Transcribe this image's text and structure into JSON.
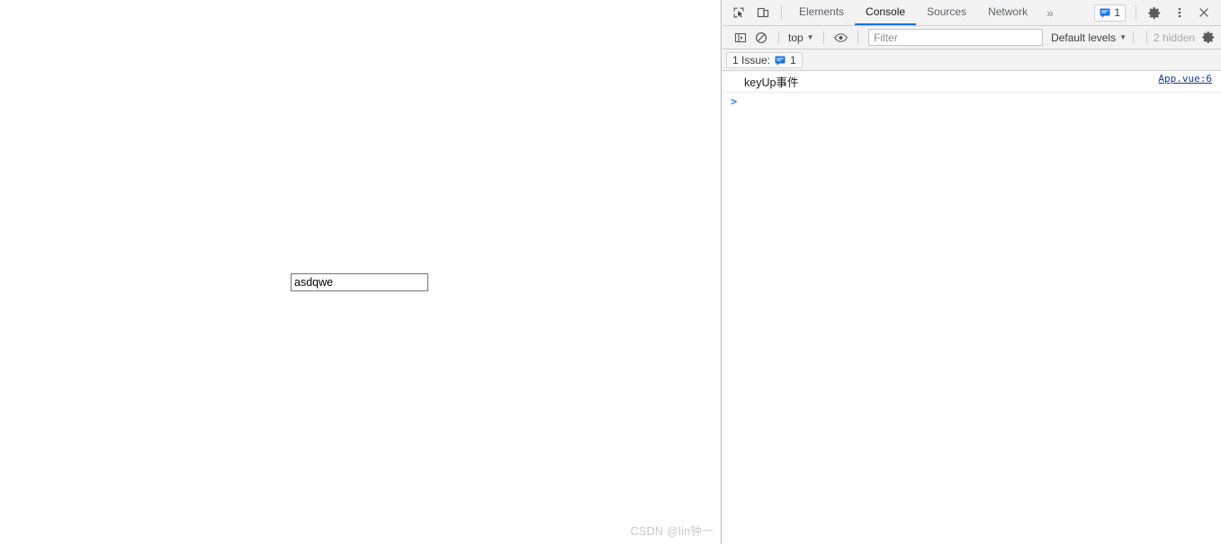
{
  "page": {
    "input": {
      "value": "asdqwe",
      "placeholder": ""
    },
    "watermark": "CSDN @lin钟一"
  },
  "devtools": {
    "toolbar_icons": {
      "inspect": "inspect-element-icon",
      "device": "device-toolbar-icon"
    },
    "tabs": [
      {
        "label": "Elements",
        "active": false
      },
      {
        "label": "Console",
        "active": true
      },
      {
        "label": "Sources",
        "active": false
      },
      {
        "label": "Network",
        "active": false
      }
    ],
    "more_tabs_label": "»",
    "issue_badge_count": "1",
    "right_icons": {
      "settings": "gear-icon",
      "more": "kebab-menu-icon",
      "close": "close-icon"
    },
    "console_toolbar": {
      "sidebar_toggle": "console-sidebar-icon",
      "clear": "clear-console-icon",
      "context": "top",
      "eye": "live-expression-eye-icon",
      "filter_placeholder": "Filter",
      "filter_value": "",
      "levels": "Default levels",
      "hidden_count": "2 hidden",
      "settings": "gear-icon"
    },
    "issue_bar": {
      "label": "1 Issue:",
      "count": "1"
    },
    "console": {
      "messages": [
        {
          "text": "keyUp事件",
          "source": "App.vue:6"
        }
      ],
      "prompt_caret": ">"
    }
  },
  "colors": {
    "accent_blue": "#1a73e8",
    "link_navy": "#1d3a8a",
    "toolbar_bg": "#f3f3f3",
    "border": "#cdcdcd",
    "watermark": "#c8c8c8"
  }
}
